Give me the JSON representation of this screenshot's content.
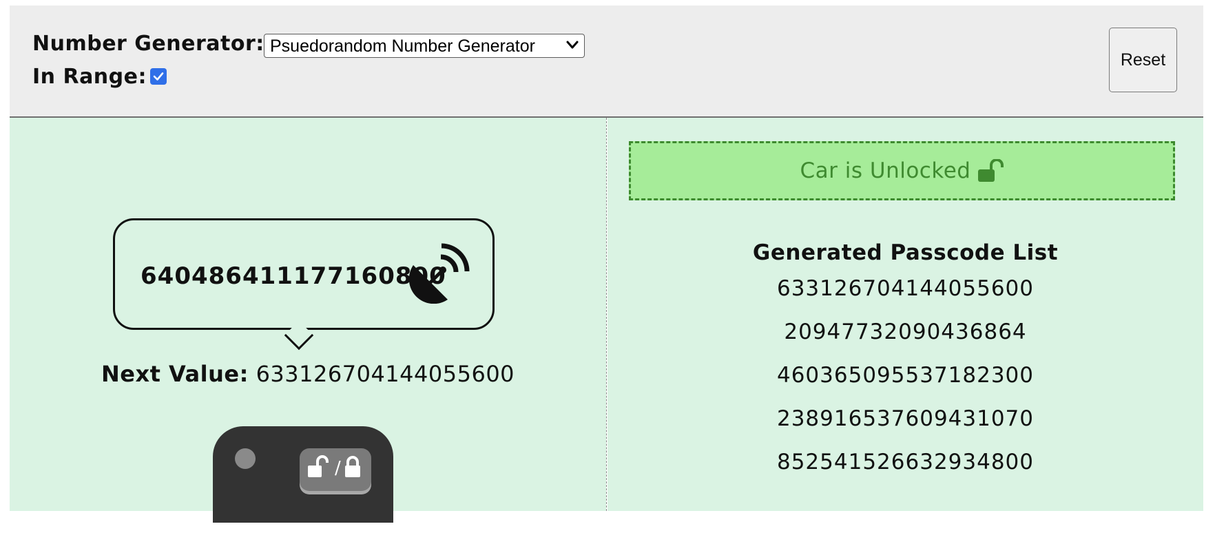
{
  "controls": {
    "generator_label": "Number Generator:",
    "generator_selected": "Psuedorandom Number Generator",
    "in_range_label": "In Range:",
    "in_range_checked": true,
    "reset_label": "Reset"
  },
  "transmitter": {
    "current_value": "640486411177160800",
    "next_value_label": "Next Value:",
    "next_value": "633126704144055600"
  },
  "fob": {
    "button_separator": "/"
  },
  "status": {
    "text": "Car is Unlocked",
    "state": "unlocked",
    "color": "#3f8a30",
    "background": "#a6ec99"
  },
  "passcodes": {
    "title": "Generated Passcode List",
    "items": [
      "633126704144055600",
      "20947732090436864",
      "460365095537182300",
      "238916537609431070",
      "852541526632934800"
    ]
  },
  "colors": {
    "panel_bg": "#daf3e3",
    "control_bg": "#ededed",
    "checkbox_accent": "#2f6fe8",
    "fob_body": "#333333"
  }
}
